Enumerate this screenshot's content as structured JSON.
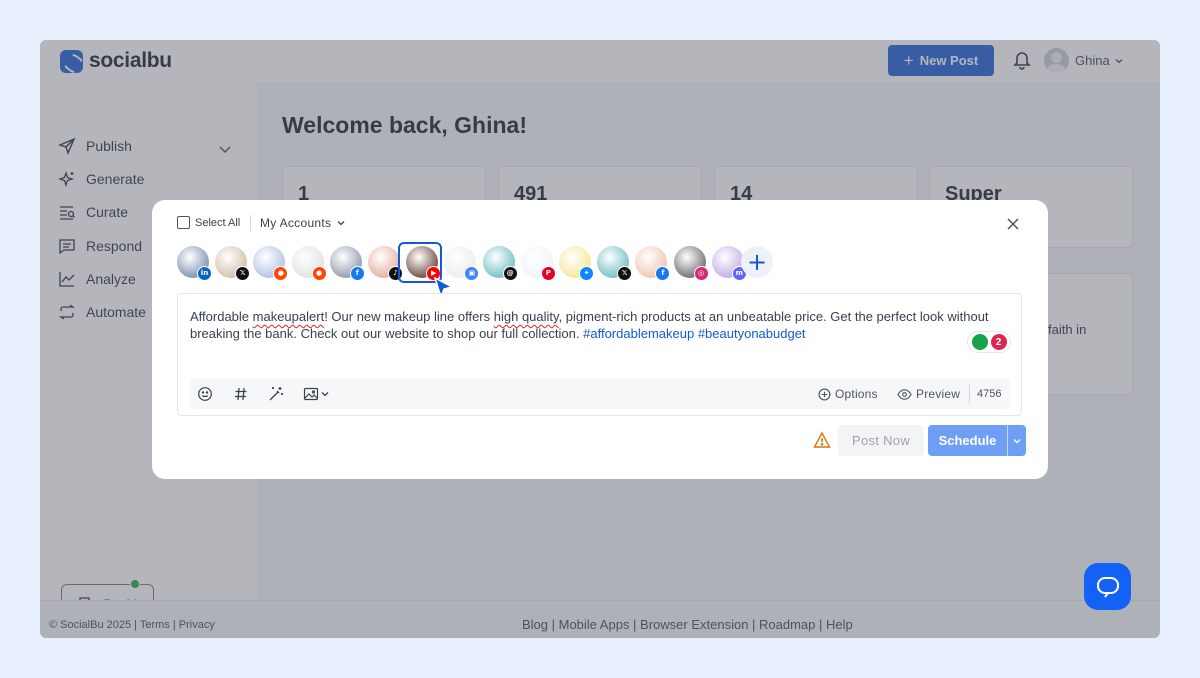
{
  "app": {
    "name": "socialbu"
  },
  "header": {
    "new_post_label": "New Post",
    "user_name": "Ghina"
  },
  "sidebar": {
    "items": [
      {
        "label": "Publish"
      },
      {
        "label": "Generate"
      },
      {
        "label": "Curate"
      },
      {
        "label": "Respond"
      },
      {
        "label": "Analyze"
      },
      {
        "label": "Automate"
      }
    ],
    "bu_ai_label": "Bu AI"
  },
  "main": {
    "welcome": "Welcome back, Ghina!",
    "stats": [
      "1",
      "491",
      "14",
      "Super"
    ],
    "panel_text": "faith in"
  },
  "footer": {
    "copyright": "© SocialBu 2025 | Terms | Privacy",
    "links": "Blog | Mobile Apps | Browser Extension | Roadmap | Help"
  },
  "composer": {
    "select_all": "Select All",
    "accounts_dropdown": "My Accounts",
    "accounts": [
      {
        "network": "linkedin",
        "badge": "in",
        "color": "#0a66c2",
        "avatar": "#8a9bb8"
      },
      {
        "network": "x",
        "badge": "𝕏",
        "color": "#111111",
        "avatar": "#d6c4b0"
      },
      {
        "network": "reddit",
        "badge": "●",
        "color": "#ff4500",
        "avatar": "#b7c7e8"
      },
      {
        "network": "reddit",
        "badge": "●",
        "color": "#ff4500",
        "avatar": "#e4e4e4"
      },
      {
        "network": "facebook",
        "badge": "f",
        "color": "#1877f2",
        "avatar": "#9aa3b5"
      },
      {
        "network": "tiktok",
        "badge": "♪",
        "color": "#111111",
        "avatar": "#e8b5a6"
      },
      {
        "network": "youtube",
        "badge": "▶",
        "color": "#ff0000",
        "avatar": "#7a5a52"
      },
      {
        "network": "google-business",
        "badge": "▣",
        "color": "#4285f4",
        "avatar": "#eeeeee"
      },
      {
        "network": "threads",
        "badge": "@",
        "color": "#111111",
        "avatar": "#7fc4c9"
      },
      {
        "network": "pinterest",
        "badge": "P",
        "color": "#e60023",
        "avatar": "#f1f4fa"
      },
      {
        "network": "bluesky",
        "badge": "✦",
        "color": "#1185fe",
        "avatar": "#f7e9a3"
      },
      {
        "network": "x",
        "badge": "𝕏",
        "color": "#111111",
        "avatar": "#7fc4c9"
      },
      {
        "network": "facebook",
        "badge": "f",
        "color": "#1877f2",
        "avatar": "#f3c9b8"
      },
      {
        "network": "instagram",
        "badge": "◎",
        "color": "#d62976",
        "avatar": "#7a7a7a"
      },
      {
        "network": "mastodon",
        "badge": "m",
        "color": "#6364ff",
        "avatar": "#c9b2e6"
      }
    ],
    "post_text": {
      "p1": "Affordable ",
      "s1": "makeupalert",
      "p2": "! Our new makeup line offers ",
      "s2": "high quality",
      "p3": ", pigment-rich products at an unbeatable price. Get the perfect look without breaking the bank. Check out our website to shop our full collection. ",
      "h1": "#affordablemakeup",
      "sp": " ",
      "h2": "#beautyonabudget"
    },
    "grammar_count": "2",
    "options_label": "Options",
    "preview_label": "Preview",
    "char_count": "4756",
    "post_now_label": "Post Now",
    "schedule_label": "Schedule"
  }
}
